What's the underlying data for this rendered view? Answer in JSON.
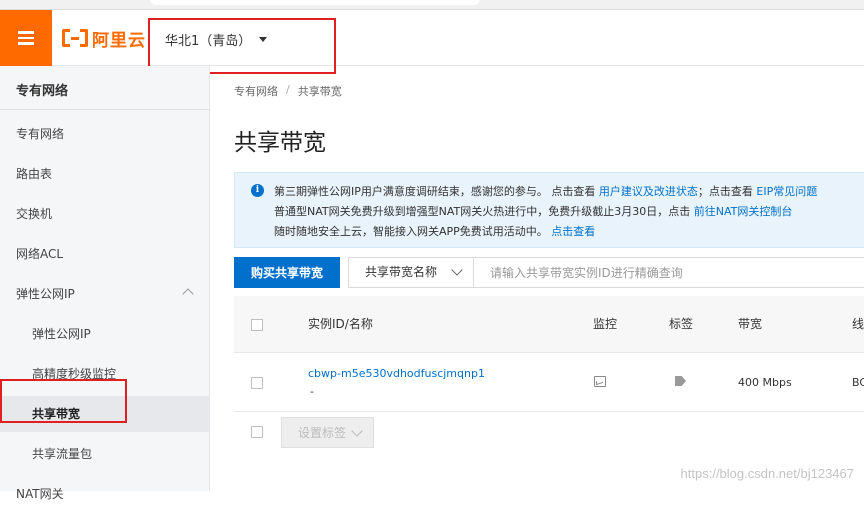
{
  "topbar": {
    "logo_text": "阿里云",
    "region": "华北1（青岛）",
    "colors": {
      "brand": "#ff6a00"
    }
  },
  "sidebar": {
    "title": "专有网络",
    "items": [
      {
        "label": "专有网络"
      },
      {
        "label": "路由表"
      },
      {
        "label": "交换机"
      },
      {
        "label": "网络ACL"
      },
      {
        "label": "弹性公网IP"
      },
      {
        "label": "弹性公网IP"
      },
      {
        "label": "高精度秒级监控"
      },
      {
        "label": "共享带宽"
      },
      {
        "label": "共享流量包"
      },
      {
        "label": "NAT网关"
      }
    ]
  },
  "main": {
    "breadcrumb": [
      "专有网络",
      "/",
      "共享带宽"
    ],
    "title": "共享带宽",
    "notice": {
      "line1_text": "第三期弹性公网IP用户满意度调研结束，感谢您的参与。 点击查看 ",
      "line1_link1": "用户建议及改进状态",
      "line1_mid": "；点击查看 ",
      "line1_link2": "EIP常见问题",
      "line2_text": "普通型NAT网关免费升级到增强型NAT网关火热进行中，免费升级截止3月30日，点击 ",
      "line2_link": "前往NAT网关控制台",
      "line3_text": "随时随地安全上云，智能接入网关APP免费试用活动中。 ",
      "line3_link": "点击查看"
    },
    "actions": {
      "buy_button": "购买共享带宽",
      "filter_select": "共享带宽名称",
      "search_placeholder": "请输入共享带宽实例ID进行精确查询"
    },
    "table": {
      "headers": [
        "实例ID/名称",
        "监控",
        "标签",
        "带宽",
        "线"
      ],
      "rows": [
        {
          "id": "cbwp-m5e530vdhodfuscjmqnp1",
          "name": "-",
          "bandwidth": "400 Mbps",
          "line": "BG"
        }
      ],
      "footer_button": "设置标签"
    },
    "accent_color": "#0070cc"
  },
  "watermark": "https://blog.csdn.net/bj123467"
}
